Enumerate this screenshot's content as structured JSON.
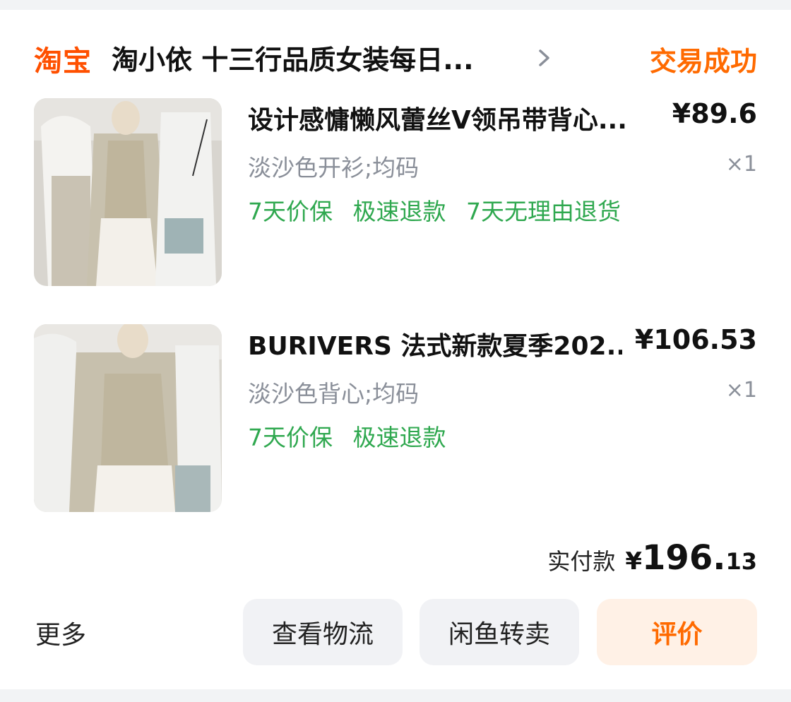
{
  "shop": {
    "platform_logo": "淘宝",
    "name": "淘小依 十三行品质女装每日...",
    "chevron_icon": "chevron-right-icon",
    "status": "交易成功"
  },
  "items": [
    {
      "image": "product-photo",
      "title": "设计感慵懒风蕾丝V领吊带背心...",
      "price": "¥89.6",
      "sku": "淡沙色开衫;均码",
      "qty": "×1",
      "tags": [
        "7天价保",
        "极速退款",
        "7天无理由退货"
      ]
    },
    {
      "image": "product-photo",
      "title": "BURIVERS 法式新款夏季202...",
      "price": "¥106.53",
      "sku": "淡沙色背心;均码",
      "qty": "×1",
      "tags": [
        "7天价保",
        "极速退款"
      ]
    }
  ],
  "payment": {
    "label": "实付款",
    "currency": "¥",
    "amount_int": "196.",
    "amount_dec": "13"
  },
  "actions": {
    "more": "更多",
    "logistics": "查看物流",
    "resale": "闲鱼转卖",
    "review": "评价"
  },
  "colors": {
    "brand": "#ff5000",
    "status": "#ff6a00",
    "tag_green": "#2fa84f",
    "review_bg": "#fff1e6"
  }
}
